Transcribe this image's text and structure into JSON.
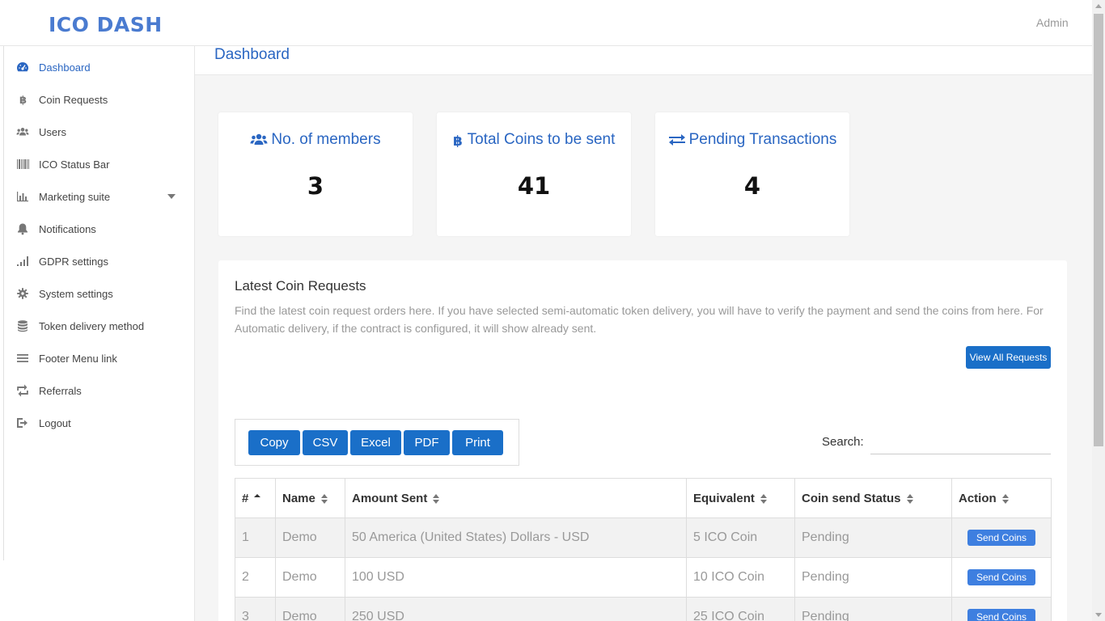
{
  "brand": "ICO DASH",
  "user": "Admin",
  "page_title": "Dashboard",
  "sidebar": {
    "items": [
      {
        "label": "Dashboard",
        "icon": "dashboard-icon"
      },
      {
        "label": "Coin Requests",
        "icon": "bitcoin-icon"
      },
      {
        "label": "Users",
        "icon": "users-icon"
      },
      {
        "label": "ICO Status Bar",
        "icon": "barcode-icon"
      },
      {
        "label": "Marketing suite",
        "icon": "bar-chart-icon"
      },
      {
        "label": "Notifications",
        "icon": "bell-icon"
      },
      {
        "label": "GDPR settings",
        "icon": "signal-icon"
      },
      {
        "label": "System settings",
        "icon": "gear-icon"
      },
      {
        "label": "Token delivery method",
        "icon": "database-icon"
      },
      {
        "label": "Footer Menu link",
        "icon": "menu-icon"
      },
      {
        "label": "Referrals",
        "icon": "retweet-icon"
      },
      {
        "label": "Logout",
        "icon": "sign-out-icon"
      }
    ]
  },
  "stats": [
    {
      "label": "No. of members",
      "value": "3",
      "icon": "users-icon"
    },
    {
      "label": "Total Coins to be sent",
      "value": "41",
      "icon": "bitcoin-icon"
    },
    {
      "label": "Pending Transactions",
      "value": "4",
      "icon": "exchange-icon"
    }
  ],
  "requests": {
    "title": "Latest Coin Requests",
    "description": "Find the latest coin request orders here. If you have selected semi-automatic token delivery, you will have to verify the payment and send the coins from here. For Automatic delivery, if the contract is configured, it will show already sent.",
    "view_all_label": "View All Requests",
    "export_buttons": [
      "Copy",
      "CSV",
      "Excel",
      "PDF",
      "Print"
    ],
    "search_label": "Search:",
    "search_value": "",
    "columns": [
      "#",
      "Name",
      "Amount Sent",
      "Equivalent",
      "Coin send Status",
      "Action"
    ],
    "rows": [
      {
        "num": "1",
        "name": "Demo",
        "amount": "50 America (United States) Dollars - USD",
        "equivalent": "5 ICO Coin",
        "status": "Pending",
        "action": "Send Coins"
      },
      {
        "num": "2",
        "name": "Demo",
        "amount": "100 USD",
        "equivalent": "10 ICO Coin",
        "status": "Pending",
        "action": "Send Coins"
      },
      {
        "num": "3",
        "name": "Demo",
        "amount": "250 USD",
        "equivalent": "25 ICO Coin",
        "status": "Pending",
        "action": "Send Coins"
      }
    ]
  },
  "colors": {
    "accent": "#2a66c2",
    "brand": "#4a7bd0",
    "button": "#1a6fc8",
    "send_button": "#3e7fe0"
  }
}
